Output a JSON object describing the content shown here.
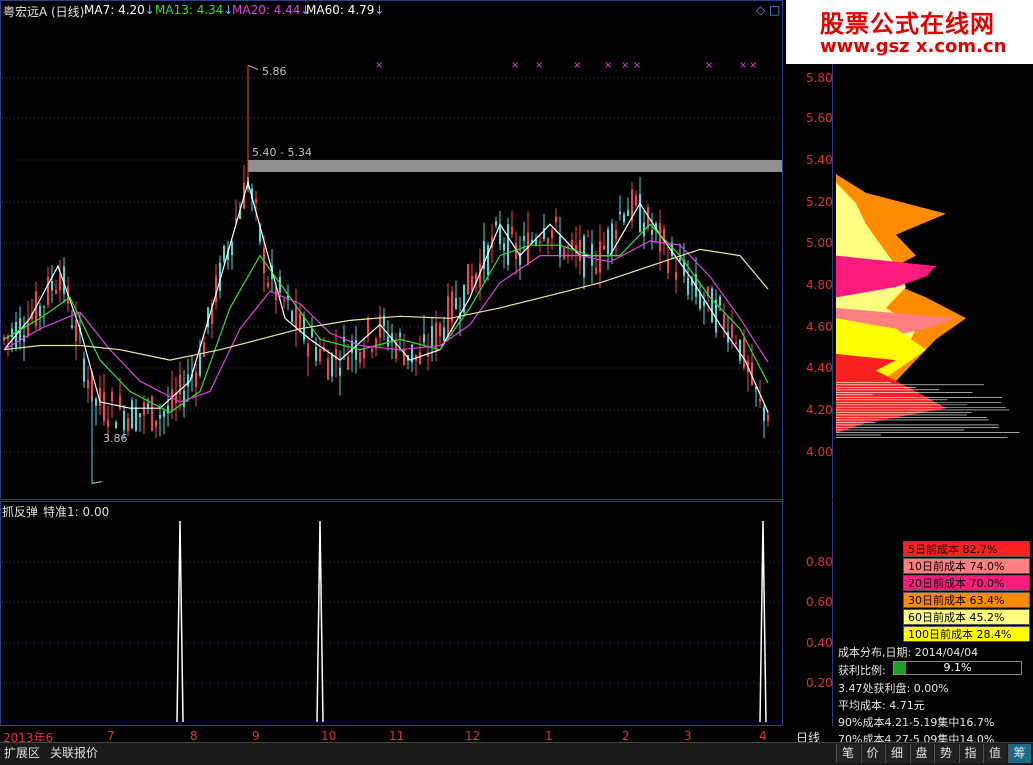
{
  "header": {
    "stock_name": "粤宏远A",
    "period": "(日线)",
    "ma": [
      {
        "label": "MA7:",
        "value": "4.20",
        "arrow": "↓",
        "color": "#ffffff"
      },
      {
        "label": "MA13:",
        "value": "4.34",
        "arrow": "↓",
        "color": "#30e030"
      },
      {
        "label": "MA20:",
        "value": "4.44",
        "arrow": "↓",
        "color": "#e040e0"
      },
      {
        "label": "MA60:",
        "value": "4.79",
        "arrow": "↓",
        "color": "#ffffff"
      }
    ],
    "corner_icons": "◇ □"
  },
  "logo": {
    "line1": "股票公式在线网",
    "line2": "www.gsz x.com.cn"
  },
  "main_chart": {
    "price_labels": [
      "5.80",
      "5.60",
      "5.40",
      "5.20",
      "5.00",
      "4.80",
      "4.60",
      "4.40",
      "4.20",
      "4.00"
    ],
    "high_marker": "5.86",
    "low_marker": "3.86",
    "resistance_label": "5.40 - 5.34"
  },
  "sub_chart": {
    "title": "抓反弹",
    "indicator_label": "特准1: 0.00",
    "y_labels": [
      "0.80",
      "0.60",
      "0.40",
      "0.20"
    ]
  },
  "x_axis": {
    "labels": [
      "2013年6",
      "7",
      "8",
      "9",
      "10",
      "11",
      "12",
      "1",
      "2",
      "3",
      "4"
    ],
    "period_label": "日线"
  },
  "cost_legend": [
    {
      "text": "5日前成本 82.7%",
      "color": "#ff2020"
    },
    {
      "text": "10日前成本 74.0%",
      "color": "#ff8080"
    },
    {
      "text": "20日前成本 70.0%",
      "color": "#ff1a80"
    },
    {
      "text": "30日前成本 63.4%",
      "color": "#ff8c00"
    },
    {
      "text": "60日前成本 45.2%",
      "color": "#ffff80"
    },
    {
      "text": "100日前成本 28.4%",
      "color": "#ffff00"
    }
  ],
  "cost_info": {
    "date_line": "成本分布,日期: 2014/04/04",
    "profit_label": "获利比例:",
    "profit_value": "9.1%",
    "profit_fraction": 0.091,
    "line3": "3.47处获利盘: 0.00%",
    "line4": "平均成本: 4.71元",
    "line5": "90%成本4.21-5.19集中16.7%",
    "line6": "70%成本4.27-5.09集中14.0%"
  },
  "bottom_bar": {
    "tabs": [
      "扩展区",
      "关联报价"
    ],
    "side_tabs": [
      "笔",
      "价",
      "细",
      "盘",
      "势",
      "指",
      "值",
      "筹"
    ]
  }
}
